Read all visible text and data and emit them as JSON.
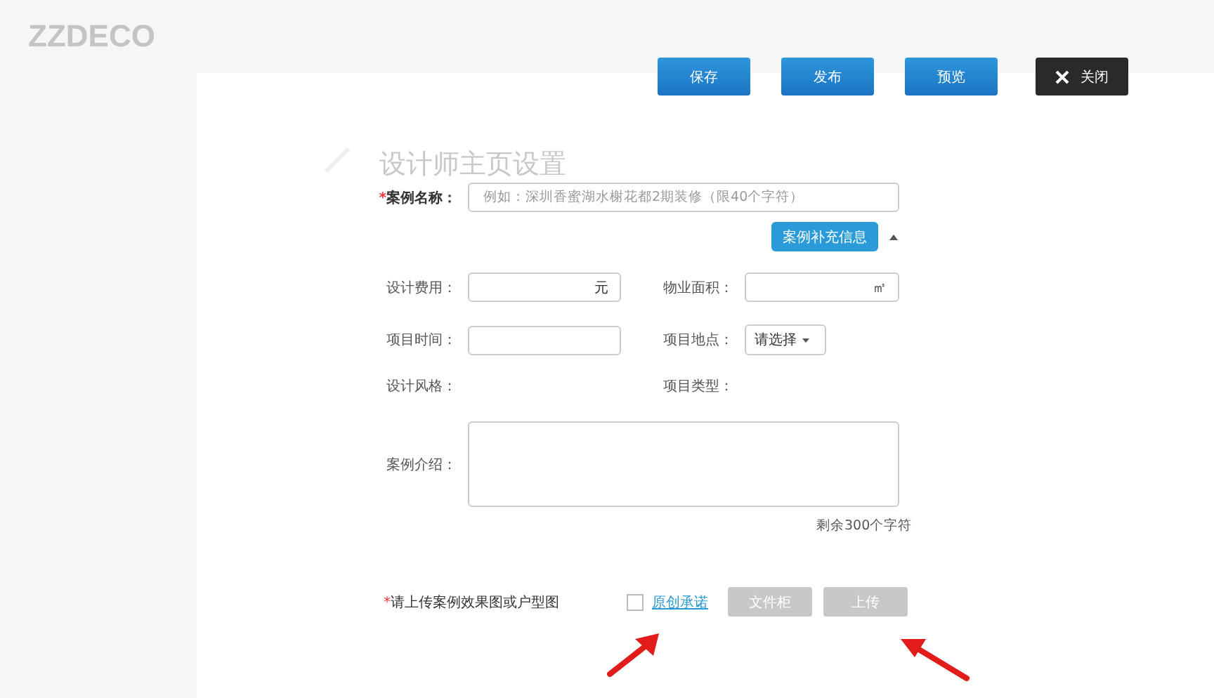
{
  "background": {
    "logo": "ZZDECO",
    "page_title": "设计师主页设置"
  },
  "toolbar": [
    {
      "label": "保存",
      "kind": "primary"
    },
    {
      "label": "发布",
      "kind": "primary"
    },
    {
      "label": "预览",
      "kind": "primary"
    },
    {
      "label": "关闭",
      "kind": "close"
    }
  ],
  "case_name": {
    "label": "案例名称：",
    "required_mark": "*",
    "placeholder": "例如：深圳香蜜湖水榭花都2期装修（限40个字符）"
  },
  "extra_info": {
    "label": "案例补充信息",
    "expanded": true
  },
  "details": [
    [
      {
        "label": "设计费用：",
        "kind": "input",
        "unit": "元"
      },
      {
        "label": "物业面积：",
        "kind": "input",
        "unit": "㎡"
      }
    ],
    [
      {
        "label": "项目时间：",
        "kind": "input"
      },
      {
        "label": "项目地点：",
        "kind": "select",
        "value": "请选择"
      }
    ],
    [
      {
        "label": "设计风格：",
        "kind": "text"
      },
      {
        "label": "项目类型：",
        "kind": "text"
      }
    ]
  ],
  "intro": {
    "label": "案例介绍：",
    "counter": "剩余300个字符"
  },
  "upload": {
    "label": "请上传案例效果图或户型图",
    "required_mark": "*",
    "agree": {
      "label": "原创承诺",
      "checked": false
    },
    "buttons": [
      {
        "label": "文件柜",
        "disabled": true
      },
      {
        "label": "上传",
        "disabled": true
      }
    ]
  }
}
